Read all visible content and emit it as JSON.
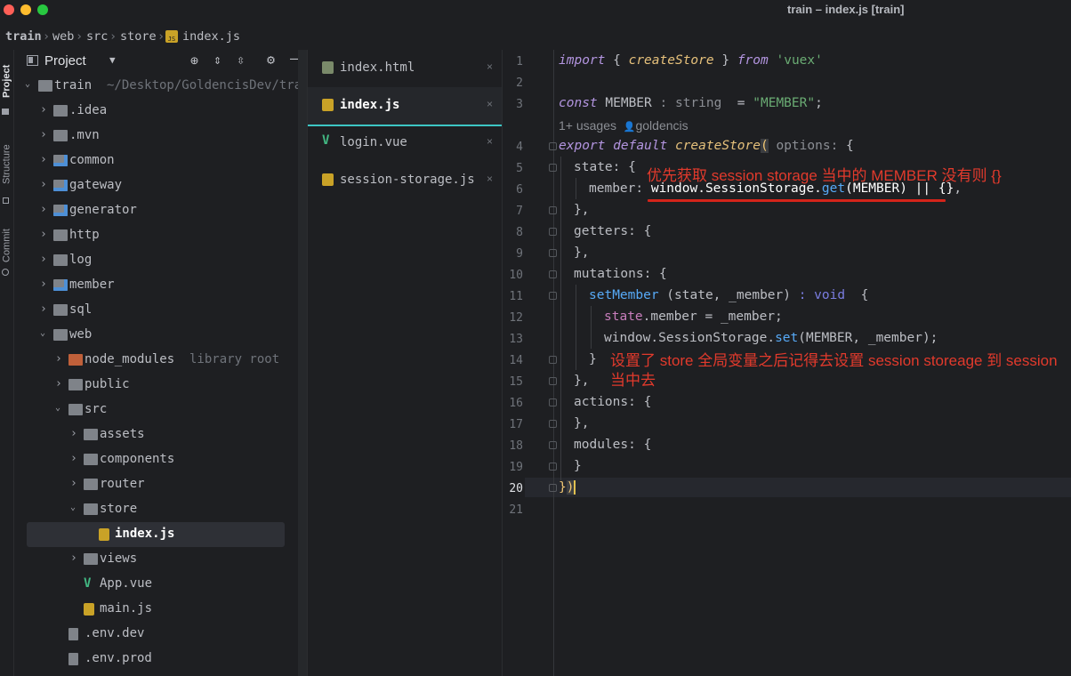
{
  "window": {
    "title": "train – index.js [train]",
    "traffic_lights": [
      "#ff5f57",
      "#febc2e",
      "#28c840"
    ]
  },
  "breadcrumb": [
    "train",
    "web",
    "src",
    "store",
    "index.js"
  ],
  "toolstrip": {
    "tabs": [
      "Project",
      "Structure",
      "Commit"
    ]
  },
  "project_panel": {
    "title": "Project",
    "root": {
      "name": "train",
      "path": "~/Desktop/GoldencisDev/tra"
    },
    "items": [
      {
        "name": ".idea"
      },
      {
        "name": ".mvn"
      },
      {
        "name": "common"
      },
      {
        "name": "gateway"
      },
      {
        "name": "generator"
      },
      {
        "name": "http"
      },
      {
        "name": "log"
      },
      {
        "name": "member"
      },
      {
        "name": "sql"
      },
      {
        "name": "web"
      },
      {
        "name": "node_modules",
        "hint": "library root"
      },
      {
        "name": "public"
      },
      {
        "name": "src"
      },
      {
        "name": "assets"
      },
      {
        "name": "components"
      },
      {
        "name": "router"
      },
      {
        "name": "store"
      },
      {
        "name": "index.js"
      },
      {
        "name": "views"
      },
      {
        "name": "App.vue"
      },
      {
        "name": "main.js"
      },
      {
        "name": ".env.dev"
      },
      {
        "name": ".env.prod"
      }
    ]
  },
  "open_files": [
    {
      "name": "index.html",
      "close": "×"
    },
    {
      "name": "index.js",
      "close": "×"
    },
    {
      "name": "login.vue",
      "close": "×"
    },
    {
      "name": "session-storage.js",
      "close": "×"
    }
  ],
  "editor": {
    "line_numbers": [
      "1",
      "2",
      "3",
      "4",
      "5",
      "6",
      "7",
      "8",
      "9",
      "10",
      "11",
      "12",
      "13",
      "14",
      "15",
      "16",
      "17",
      "18",
      "19",
      "20",
      "21"
    ],
    "usages_hint": "1+ usages",
    "author_hint": "goldencis",
    "type_hint_string": ": string",
    "param_hint_options": "options:",
    "return_hint_void": ": void",
    "annotation_1": "优先获取 session storage 当中的 MEMBER 没有则 {}",
    "annotation_2_line1": "设置了 store 全局变量之后记得去设置 session storeage 到 session",
    "annotation_2_line2": "当中去"
  },
  "colors": {
    "accent_tab": "#3dc6c4",
    "annotation_red": "#e23a2c",
    "background": "#1e1f22"
  }
}
